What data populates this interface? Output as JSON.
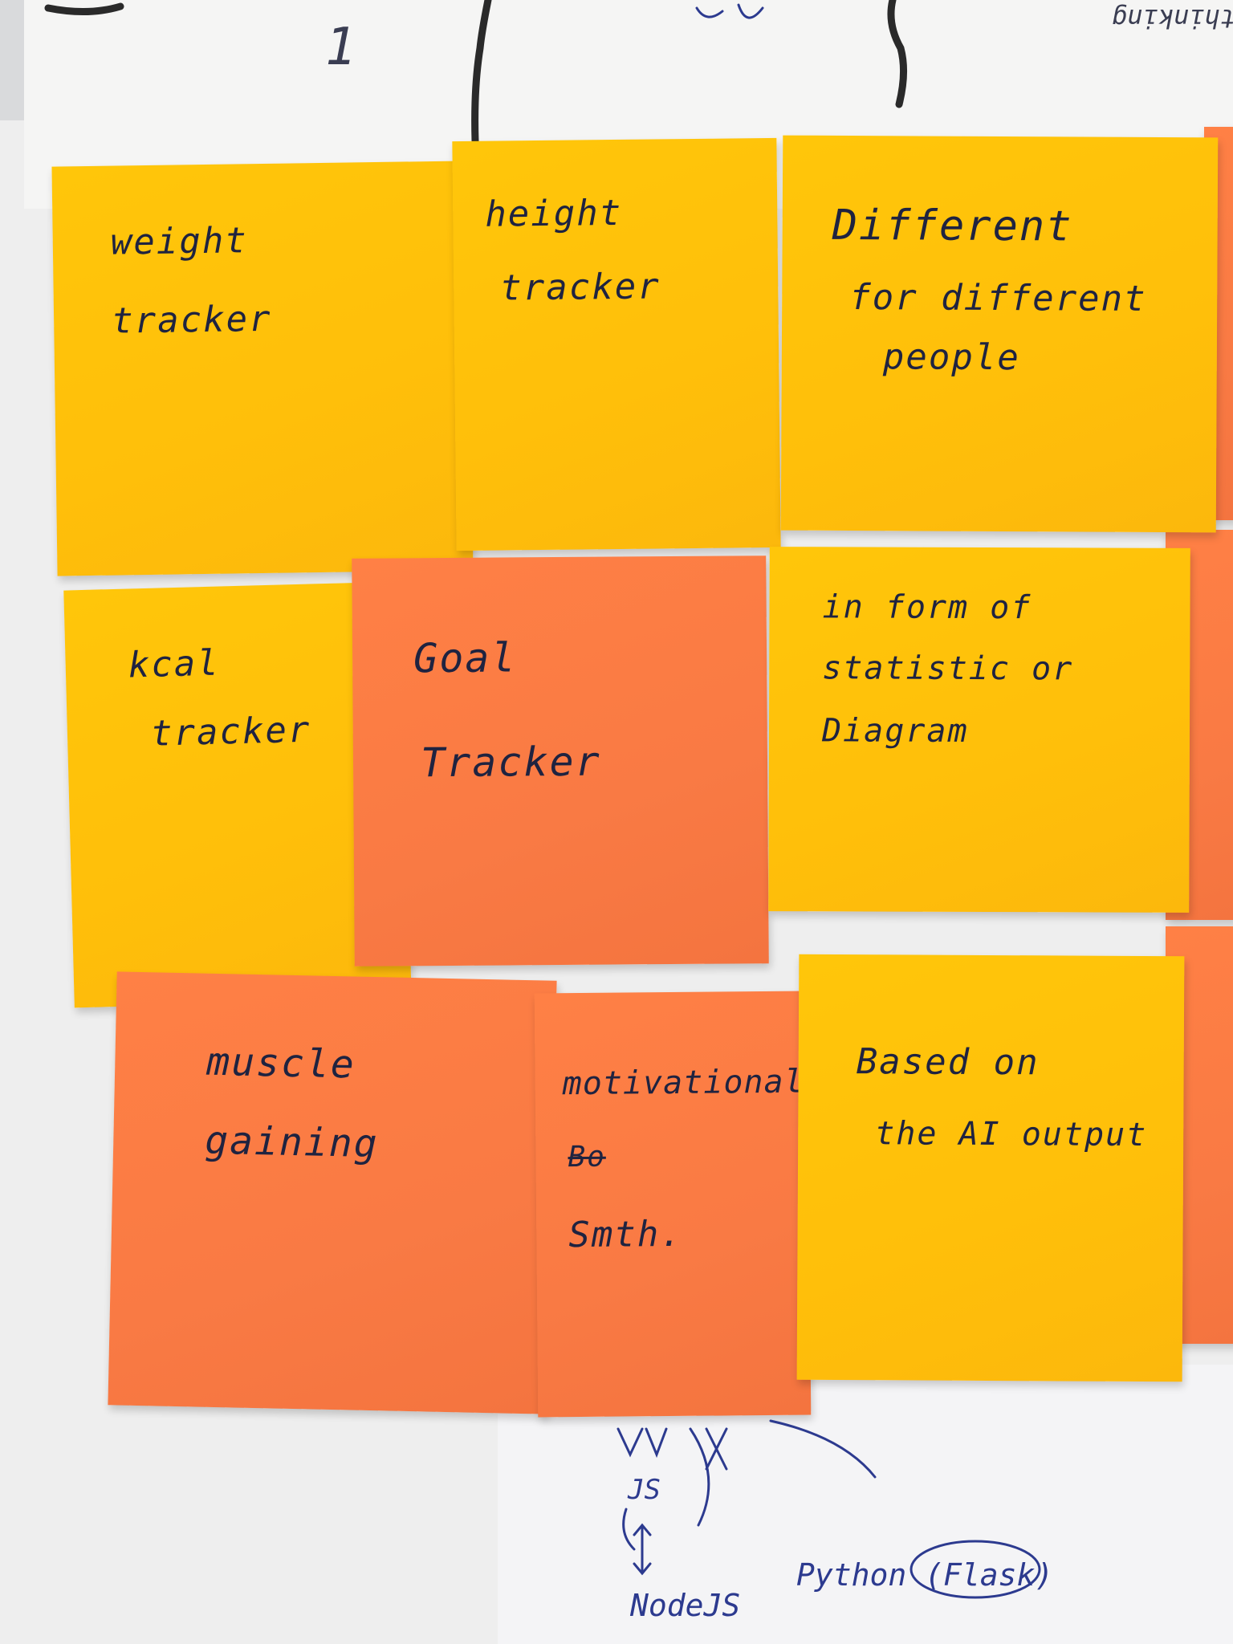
{
  "photo": {
    "subject": "sticky notes on whiteboard paper",
    "colors": {
      "yellow": "#ffc60a",
      "orange": "#fb7b44",
      "paper": "#eeeeee",
      "ink": "#1f2340"
    }
  },
  "top_margin": {
    "left_mark": "1",
    "right_fragment": "thinking"
  },
  "notes": [
    {
      "id": "weight",
      "color": "yellow",
      "lines": [
        "weight",
        "tracker"
      ]
    },
    {
      "id": "height",
      "color": "yellow",
      "lines": [
        "height",
        "tracker"
      ]
    },
    {
      "id": "different",
      "color": "yellow",
      "lines": [
        "Different",
        "for different",
        "people"
      ]
    },
    {
      "id": "kcal",
      "color": "yellow",
      "lines": [
        "kcal",
        "tracker"
      ]
    },
    {
      "id": "goal",
      "color": "orange",
      "lines": [
        "Goal",
        "Tracker"
      ]
    },
    {
      "id": "statistic",
      "color": "yellow",
      "lines": [
        "in form of",
        "statistic or",
        "Diagram"
      ]
    },
    {
      "id": "muscle",
      "color": "orange",
      "lines": [
        "muscle",
        "gaining"
      ]
    },
    {
      "id": "motivational",
      "color": "orange",
      "lines": [
        "motivational",
        "Bo",
        "Smth."
      ]
    },
    {
      "id": "ai",
      "color": "yellow",
      "lines": [
        "Based on",
        "the AI output"
      ]
    }
  ],
  "bottom_scribbles": {
    "js": "JS",
    "nodejs": "NodeJS",
    "python": "Python (Flask)"
  }
}
